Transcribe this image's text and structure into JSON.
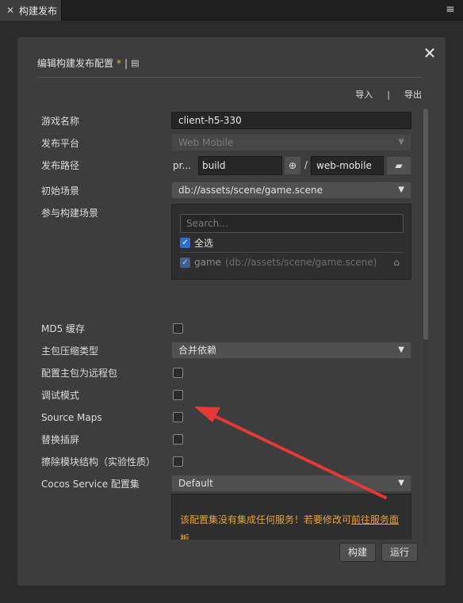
{
  "tab": {
    "label": "构建发布",
    "icon": "hammer-wrench-icon"
  },
  "panel": {
    "title": "编辑构建发布配置",
    "star": "*",
    "sep": "|",
    "import_label": "导入",
    "import_sep": "|",
    "export_label": "导出"
  },
  "fields": {
    "game_name_label": "游戏名称",
    "game_name_value": "client-h5-330",
    "platform_label": "发布平台",
    "platform_value": "Web Mobile",
    "path_label": "发布路径",
    "path_prefix": "pr...",
    "path_build": "build",
    "path_slash": "/",
    "path_dest": "web-mobile",
    "start_scene_label": "初始场景",
    "start_scene_value": "db://assets/scene/game.scene",
    "scenes_label": "参与构建场景",
    "scenes_search_placeholder": "Search...",
    "scenes_all_label": "全选",
    "scene_item_name": "game",
    "scene_item_path": "(db://assets/scene/game.scene)",
    "md5_label": "MD5 缓存",
    "compress_label": "主包压缩类型",
    "compress_value": "合并依赖",
    "remote_label": "配置主包为远程包",
    "debug_label": "调试模式",
    "sourcemaps_label": "Source Maps",
    "splash_label": "替换插屏",
    "erase_label": "擦除模块结构（实验性质）",
    "service_label": "Cocos Service 配置集",
    "service_value": "Default",
    "service_msg": "该配置集没有集成任何服务！若要修改可",
    "service_link": "前往服务面板"
  },
  "buttons": {
    "build": "构建",
    "run": "运行"
  },
  "colors": {
    "accent": "#2a6fd1",
    "warning": "#e8a23a",
    "arrow": "#e53935"
  }
}
